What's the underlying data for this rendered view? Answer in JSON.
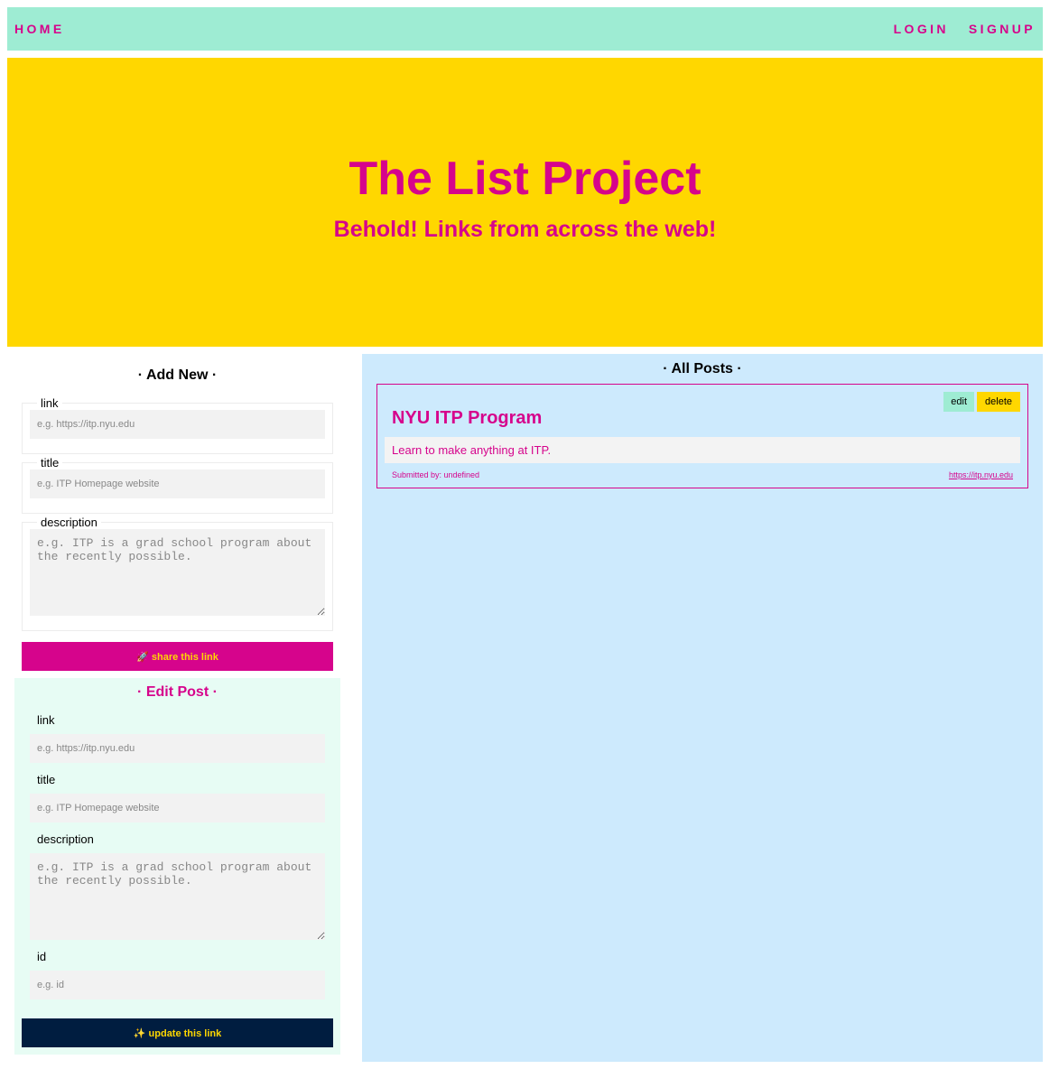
{
  "nav": {
    "home": "HOME",
    "login": "LOGIN",
    "signup": "SIGNUP"
  },
  "hero": {
    "title": "The List Project",
    "subtitle": "Behold! Links from across the web!"
  },
  "add_new": {
    "title": "· Add New ·",
    "link_label": "link",
    "link_placeholder": "e.g. https://itp.nyu.edu",
    "title_label": "title",
    "title_placeholder": "e.g. ITP Homepage website",
    "description_label": "description",
    "description_placeholder": "e.g. ITP is a grad school program about the recently possible.",
    "submit_label": "🚀 share this link"
  },
  "edit_post": {
    "title": "· Edit Post ·",
    "link_label": "link",
    "link_placeholder": "e.g. https://itp.nyu.edu",
    "title_label": "title",
    "title_placeholder": "e.g. ITP Homepage website",
    "description_label": "description",
    "description_placeholder": "e.g. ITP is a grad school program about the recently possible.",
    "id_label": "id",
    "id_placeholder": "e.g. id",
    "submit_label": "✨ update this link"
  },
  "all_posts": {
    "title": "· All Posts ·",
    "posts": [
      {
        "title": "NYU ITP Program",
        "description": "Learn to make anything at ITP.",
        "submitted_by": "Submitted by: undefined",
        "url": "https://itp.nyu.edu",
        "edit_label": "edit",
        "delete_label": "delete"
      }
    ]
  },
  "colors": {
    "nav_bg": "#9eecd3",
    "accent": "#d6048c",
    "hero_bg": "#ffd700",
    "posts_bg": "#cdeafd",
    "edit_bg": "#e7fcf4",
    "update_btn": "#001d40"
  }
}
